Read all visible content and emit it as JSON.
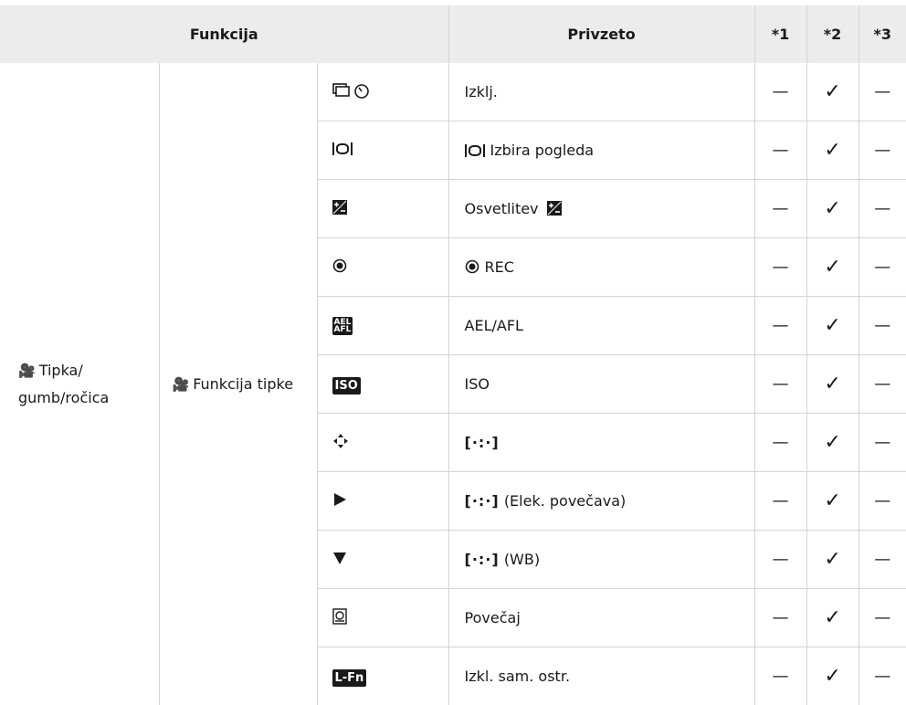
{
  "header": {
    "funkcija": "Funkcija",
    "privzeto": "Privzeto",
    "col1": "*1",
    "col2": "*2",
    "col3": "*3"
  },
  "group": {
    "level1": "Tipka/ gumb/ročica",
    "level2": "Funkcija tipke",
    "movie_icon": "movie-camera-icon"
  },
  "rows": [
    {
      "symbol_icon": "sequential-self-timer-icon",
      "setting": "Izklj.",
      "c1": "—",
      "c2": "✓",
      "c3": "—"
    },
    {
      "symbol_icon": "view-selection-icon",
      "setting": "Izbira pogleda",
      "c1": "—",
      "c2": "✓",
      "c3": "—"
    },
    {
      "symbol_icon": "exposure-compensation-icon",
      "setting": "Osvetlitev",
      "c1": "—",
      "c2": "✓",
      "c3": "—"
    },
    {
      "symbol_icon": "record-icon",
      "setting": "REC",
      "c1": "—",
      "c2": "✓",
      "c3": "—"
    },
    {
      "symbol_icon": "ael-afl-icon",
      "setting": "AEL/AFL",
      "c1": "—",
      "c2": "✓",
      "c3": "—"
    },
    {
      "symbol_icon": "iso-icon",
      "setting": "ISO",
      "c1": "—",
      "c2": "✓",
      "c3": "—"
    },
    {
      "symbol_icon": "arrow-pad-icon",
      "setting": "[·:·]",
      "c1": "—",
      "c2": "✓",
      "c3": "—"
    },
    {
      "symbol_icon": "play-icon",
      "setting": "(Elek. povečava)",
      "setting_prefix": "[·:·]",
      "c1": "—",
      "c2": "✓",
      "c3": "—"
    },
    {
      "symbol_icon": "down-triangle-icon",
      "setting": "(WB)",
      "setting_prefix": "[·:·]",
      "c1": "—",
      "c2": "✓",
      "c3": "—"
    },
    {
      "symbol_icon": "magnify-icon",
      "setting": "Povečaj",
      "c1": "—",
      "c2": "✓",
      "c3": "—"
    },
    {
      "symbol_icon": "l-fn-icon",
      "setting": "Izkl. sam. ostr.",
      "c1": "—",
      "c2": "✓",
      "c3": "—"
    }
  ],
  "icon_text": {
    "ael_top": "AEL",
    "ael_bottom": "AFL",
    "iso": "ISO",
    "lfn": "L-Fn"
  }
}
